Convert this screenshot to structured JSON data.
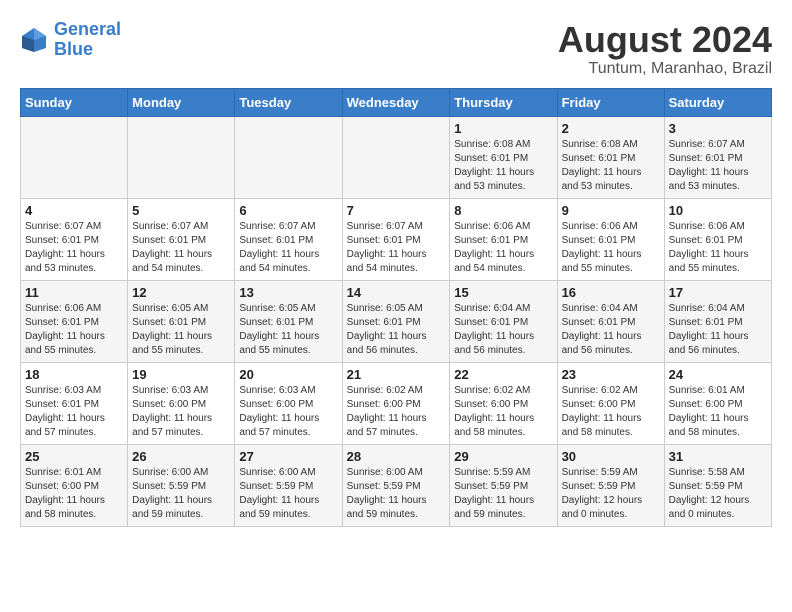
{
  "header": {
    "logo_line1": "General",
    "logo_line2": "Blue",
    "title": "August 2024",
    "subtitle": "Tuntum, Maranhao, Brazil"
  },
  "weekdays": [
    "Sunday",
    "Monday",
    "Tuesday",
    "Wednesday",
    "Thursday",
    "Friday",
    "Saturday"
  ],
  "weeks": [
    [
      {
        "day": "",
        "info": ""
      },
      {
        "day": "",
        "info": ""
      },
      {
        "day": "",
        "info": ""
      },
      {
        "day": "",
        "info": ""
      },
      {
        "day": "1",
        "info": "Sunrise: 6:08 AM\nSunset: 6:01 PM\nDaylight: 11 hours\nand 53 minutes."
      },
      {
        "day": "2",
        "info": "Sunrise: 6:08 AM\nSunset: 6:01 PM\nDaylight: 11 hours\nand 53 minutes."
      },
      {
        "day": "3",
        "info": "Sunrise: 6:07 AM\nSunset: 6:01 PM\nDaylight: 11 hours\nand 53 minutes."
      }
    ],
    [
      {
        "day": "4",
        "info": "Sunrise: 6:07 AM\nSunset: 6:01 PM\nDaylight: 11 hours\nand 53 minutes."
      },
      {
        "day": "5",
        "info": "Sunrise: 6:07 AM\nSunset: 6:01 PM\nDaylight: 11 hours\nand 54 minutes."
      },
      {
        "day": "6",
        "info": "Sunrise: 6:07 AM\nSunset: 6:01 PM\nDaylight: 11 hours\nand 54 minutes."
      },
      {
        "day": "7",
        "info": "Sunrise: 6:07 AM\nSunset: 6:01 PM\nDaylight: 11 hours\nand 54 minutes."
      },
      {
        "day": "8",
        "info": "Sunrise: 6:06 AM\nSunset: 6:01 PM\nDaylight: 11 hours\nand 54 minutes."
      },
      {
        "day": "9",
        "info": "Sunrise: 6:06 AM\nSunset: 6:01 PM\nDaylight: 11 hours\nand 55 minutes."
      },
      {
        "day": "10",
        "info": "Sunrise: 6:06 AM\nSunset: 6:01 PM\nDaylight: 11 hours\nand 55 minutes."
      }
    ],
    [
      {
        "day": "11",
        "info": "Sunrise: 6:06 AM\nSunset: 6:01 PM\nDaylight: 11 hours\nand 55 minutes."
      },
      {
        "day": "12",
        "info": "Sunrise: 6:05 AM\nSunset: 6:01 PM\nDaylight: 11 hours\nand 55 minutes."
      },
      {
        "day": "13",
        "info": "Sunrise: 6:05 AM\nSunset: 6:01 PM\nDaylight: 11 hours\nand 55 minutes."
      },
      {
        "day": "14",
        "info": "Sunrise: 6:05 AM\nSunset: 6:01 PM\nDaylight: 11 hours\nand 56 minutes."
      },
      {
        "day": "15",
        "info": "Sunrise: 6:04 AM\nSunset: 6:01 PM\nDaylight: 11 hours\nand 56 minutes."
      },
      {
        "day": "16",
        "info": "Sunrise: 6:04 AM\nSunset: 6:01 PM\nDaylight: 11 hours\nand 56 minutes."
      },
      {
        "day": "17",
        "info": "Sunrise: 6:04 AM\nSunset: 6:01 PM\nDaylight: 11 hours\nand 56 minutes."
      }
    ],
    [
      {
        "day": "18",
        "info": "Sunrise: 6:03 AM\nSunset: 6:01 PM\nDaylight: 11 hours\nand 57 minutes."
      },
      {
        "day": "19",
        "info": "Sunrise: 6:03 AM\nSunset: 6:00 PM\nDaylight: 11 hours\nand 57 minutes."
      },
      {
        "day": "20",
        "info": "Sunrise: 6:03 AM\nSunset: 6:00 PM\nDaylight: 11 hours\nand 57 minutes."
      },
      {
        "day": "21",
        "info": "Sunrise: 6:02 AM\nSunset: 6:00 PM\nDaylight: 11 hours\nand 57 minutes."
      },
      {
        "day": "22",
        "info": "Sunrise: 6:02 AM\nSunset: 6:00 PM\nDaylight: 11 hours\nand 58 minutes."
      },
      {
        "day": "23",
        "info": "Sunrise: 6:02 AM\nSunset: 6:00 PM\nDaylight: 11 hours\nand 58 minutes."
      },
      {
        "day": "24",
        "info": "Sunrise: 6:01 AM\nSunset: 6:00 PM\nDaylight: 11 hours\nand 58 minutes."
      }
    ],
    [
      {
        "day": "25",
        "info": "Sunrise: 6:01 AM\nSunset: 6:00 PM\nDaylight: 11 hours\nand 58 minutes."
      },
      {
        "day": "26",
        "info": "Sunrise: 6:00 AM\nSunset: 5:59 PM\nDaylight: 11 hours\nand 59 minutes."
      },
      {
        "day": "27",
        "info": "Sunrise: 6:00 AM\nSunset: 5:59 PM\nDaylight: 11 hours\nand 59 minutes."
      },
      {
        "day": "28",
        "info": "Sunrise: 6:00 AM\nSunset: 5:59 PM\nDaylight: 11 hours\nand 59 minutes."
      },
      {
        "day": "29",
        "info": "Sunrise: 5:59 AM\nSunset: 5:59 PM\nDaylight: 11 hours\nand 59 minutes."
      },
      {
        "day": "30",
        "info": "Sunrise: 5:59 AM\nSunset: 5:59 PM\nDaylight: 12 hours\nand 0 minutes."
      },
      {
        "day": "31",
        "info": "Sunrise: 5:58 AM\nSunset: 5:59 PM\nDaylight: 12 hours\nand 0 minutes."
      }
    ]
  ]
}
